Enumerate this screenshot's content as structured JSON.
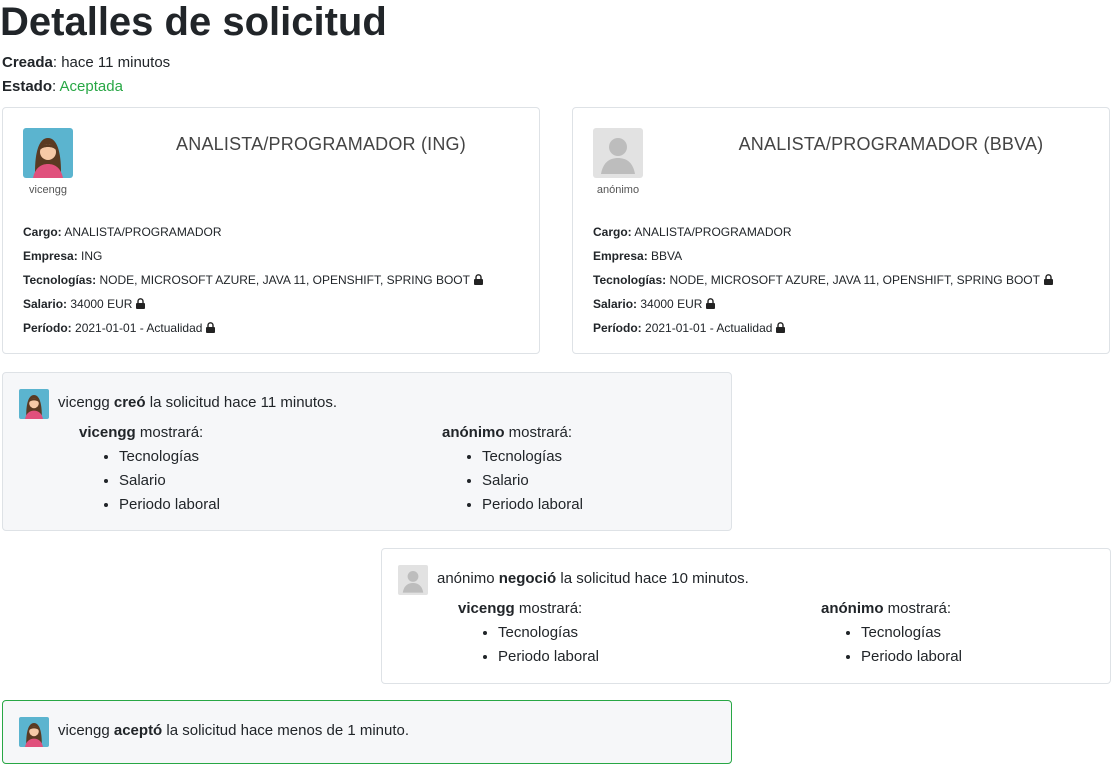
{
  "page": {
    "title": "Detalles de solicitud",
    "created_label": "Creada",
    "created_value": "hace 11 minutos",
    "status_label": "Estado",
    "status_value": "Aceptada",
    "status_color": "#28a745"
  },
  "cards": [
    {
      "user": "vicengg",
      "avatar_icon": "female-user-avatar-icon",
      "title": "ANALISTA/PROGRAMADOR (ING)",
      "fields": [
        {
          "label": "Cargo:",
          "value": "ANALISTA/PROGRAMADOR",
          "locked": false
        },
        {
          "label": "Empresa:",
          "value": "ING",
          "locked": false
        },
        {
          "label": "Tecnologías:",
          "value": "NODE, MICROSOFT AZURE, JAVA 11, OPENSHIFT, SPRING BOOT",
          "locked": true
        },
        {
          "label": "Salario:",
          "value": "34000 EUR",
          "locked": true
        },
        {
          "label": "Período:",
          "value": "2021-01-01 - Actualidad",
          "locked": true
        }
      ]
    },
    {
      "user": "anónimo",
      "avatar_icon": "anonymous-user-avatar-icon",
      "title": "ANALISTA/PROGRAMADOR (BBVA)",
      "fields": [
        {
          "label": "Cargo:",
          "value": "ANALISTA/PROGRAMADOR",
          "locked": false
        },
        {
          "label": "Empresa:",
          "value": "BBVA",
          "locked": false
        },
        {
          "label": "Tecnologías:",
          "value": "NODE, MICROSOFT AZURE, JAVA 11, OPENSHIFT, SPRING BOOT",
          "locked": true
        },
        {
          "label": "Salario:",
          "value": "34000 EUR",
          "locked": true
        },
        {
          "label": "Período:",
          "value": "2021-01-01 - Actualidad",
          "locked": true
        }
      ]
    }
  ],
  "events": [
    {
      "user": "vicengg",
      "action": "creó",
      "suffix": "la solicitud hace 11 minutos.",
      "show_a_user": "vicengg",
      "show_b_user": "anónimo",
      "show_label": "mostrará:",
      "show_a": [
        "Tecnologías",
        "Salario",
        "Periodo laboral"
      ],
      "show_b": [
        "Tecnologías",
        "Salario",
        "Periodo laboral"
      ]
    },
    {
      "user": "anónimo",
      "action": "negoció",
      "suffix": "la solicitud hace 10 minutos.",
      "show_a_user": "vicengg",
      "show_b_user": "anónimo",
      "show_label": "mostrará:",
      "show_a": [
        "Tecnologías",
        "Periodo laboral"
      ],
      "show_b": [
        "Tecnologías",
        "Periodo laboral"
      ]
    },
    {
      "user": "vicengg",
      "action": "aceptó",
      "suffix": "la solicitud hace menos de 1 minuto."
    }
  ],
  "icons": {
    "lock": "lock-icon",
    "accent_green": "#28a745",
    "border_gray": "#dee2e6"
  }
}
